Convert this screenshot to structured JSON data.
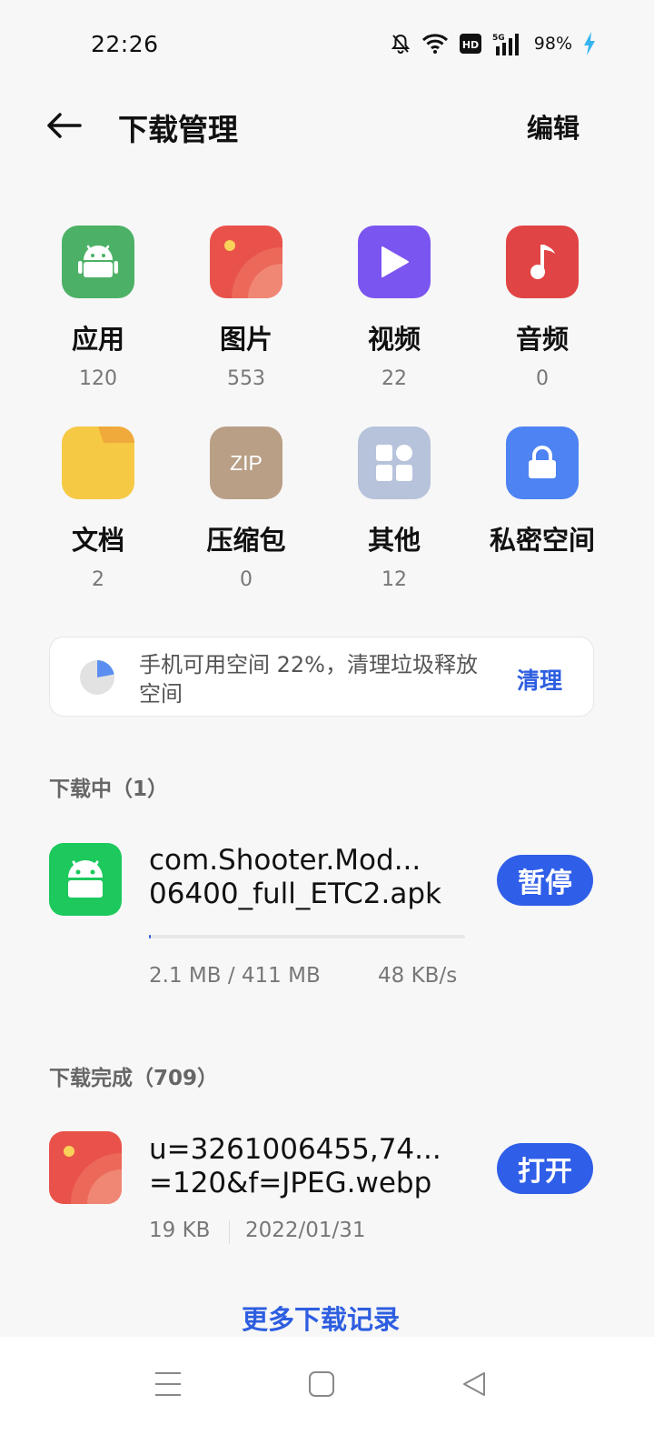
{
  "status_bar": {
    "time": "22:26",
    "network": "5G",
    "battery": "98%",
    "icons": [
      "bell-off-icon",
      "wifi-icon",
      "hd-icon",
      "signal-icon",
      "charging-icon"
    ]
  },
  "header": {
    "title": "下载管理",
    "edit_label": "编辑"
  },
  "categories": [
    {
      "label": "应用",
      "count": "120",
      "icon": "android-icon",
      "color": "#4cb166"
    },
    {
      "label": "图片",
      "count": "553",
      "icon": "image-icon",
      "color": "#e9524a"
    },
    {
      "label": "视频",
      "count": "22",
      "icon": "play-icon",
      "color": "#7b55f0"
    },
    {
      "label": "音频",
      "count": "0",
      "icon": "music-note-icon",
      "color": "#e04444"
    },
    {
      "label": "文档",
      "count": "2",
      "icon": "folder-icon",
      "color": "#f6c945"
    },
    {
      "label": "压缩包",
      "count": "0",
      "icon": "zip-icon",
      "icon_text": "ZIP",
      "color": "#b99f86"
    },
    {
      "label": "其他",
      "count": "12",
      "icon": "grid-icon",
      "color": "#b7c2db"
    },
    {
      "label": "私密空间",
      "count": "",
      "icon": "lock-icon",
      "color": "#4d83f2"
    }
  ],
  "storage": {
    "text": "手机可用空间 22%，清理垃圾释放空间",
    "available_fraction": 0.22,
    "clean_label": "清理"
  },
  "downloading": {
    "title": "下载中（1）",
    "items": [
      {
        "name_line1": "com.Shooter.Mod...",
        "name_line2": "06400_full_ETC2.apk",
        "action": "暂停",
        "progress": "2.1 MB / 411 MB",
        "progress_fraction": 0.005,
        "speed": "48 KB/s",
        "icon": "android-icon",
        "color": "#1dc85c"
      }
    ]
  },
  "completed": {
    "title": "下载完成（709）",
    "items": [
      {
        "name_line1": "u=3261006455,74...",
        "name_line2": "=120&f=JPEG.webp",
        "action": "打开",
        "size": "19 KB",
        "date": "2022/01/31",
        "icon": "image-icon",
        "color": "#e9524a"
      }
    ]
  },
  "more_label": "更多下载记录",
  "nav": {
    "icons": [
      "menu-icon",
      "home-icon",
      "back-triangle-icon"
    ]
  }
}
